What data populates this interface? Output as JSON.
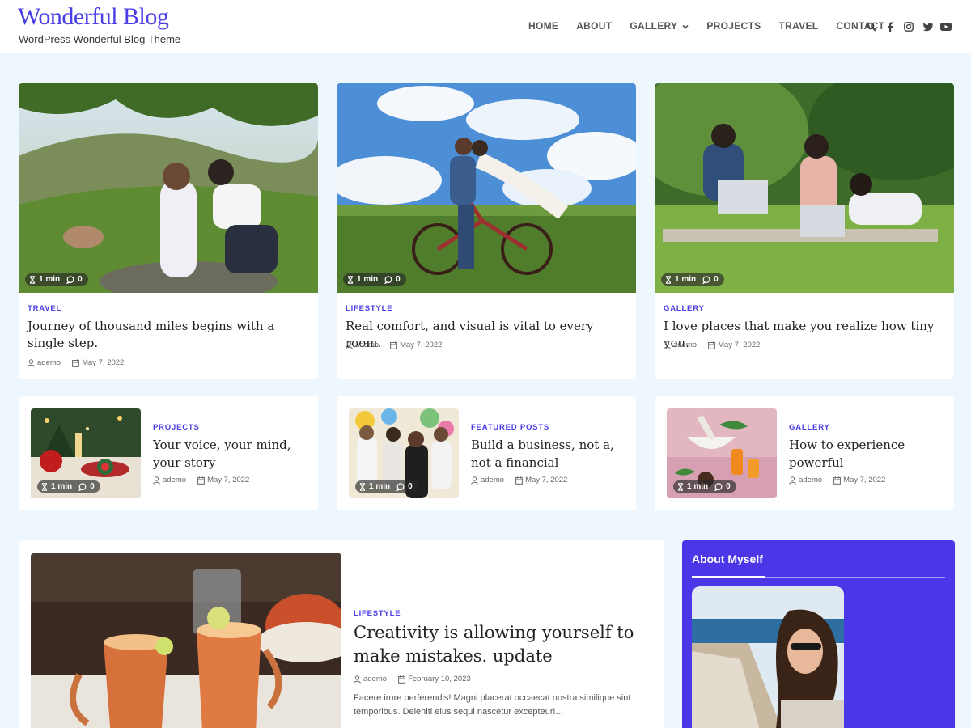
{
  "site": {
    "title": "Wonderful Blog",
    "tagline": "WordPress Wonderful Blog Theme"
  },
  "nav": {
    "items": [
      {
        "label": "HOME"
      },
      {
        "label": "ABOUT"
      },
      {
        "label": "GALLERY",
        "has_dropdown": true
      },
      {
        "label": "PROJECTS"
      },
      {
        "label": "TRAVEL"
      },
      {
        "label": "CONTACT"
      }
    ],
    "icons": [
      "search-icon",
      "facebook-icon",
      "instagram-icon",
      "twitter-icon",
      "youtube-icon"
    ]
  },
  "colors": {
    "accent": "#4a3ee6",
    "page_bg": "#eef7fd"
  },
  "featured": [
    {
      "category": "TRAVEL",
      "title": "Journey of thousand miles begins with a single step.",
      "author": "ademo",
      "date": "May 7, 2022",
      "read_time": "1 min",
      "comments": "0"
    },
    {
      "category": "LIFESTYLE",
      "title": "Real comfort, and visual is vital to every room.",
      "author": "ademo",
      "date": "May 7, 2022",
      "read_time": "1 min",
      "comments": "0"
    },
    {
      "category": "GALLERY",
      "title": "I love places that make you realize how tiny you.",
      "author": "ademo",
      "date": "May 7, 2022",
      "read_time": "1 min",
      "comments": "0"
    }
  ],
  "small_posts": [
    {
      "category": "PROJECTS",
      "title": "Your voice, your mind, your story",
      "author": "ademo",
      "date": "May 7, 2022",
      "read_time": "1 min",
      "comments": "0"
    },
    {
      "category": "FEATURED POSTS",
      "title": "Build a business, not a, not a financial",
      "author": "ademo",
      "date": "May 7, 2022",
      "read_time": "1 min",
      "comments": "0"
    },
    {
      "category": "GALLERY",
      "title": "How to experience powerful",
      "author": "ademo",
      "date": "May 7, 2022",
      "read_time": "1 min",
      "comments": "0"
    }
  ],
  "main_post": {
    "category": "LIFESTYLE",
    "title": "Creativity is allowing yourself to make mistakes. update",
    "author": "ademo",
    "date": "February 10, 2023",
    "excerpt": "Facere irure perferendis! Magni placerat occaecat nostra similique sint temporibus. Deleniti eius sequi nascetur excepteur!..."
  },
  "sidebar": {
    "title": "About Myself"
  }
}
